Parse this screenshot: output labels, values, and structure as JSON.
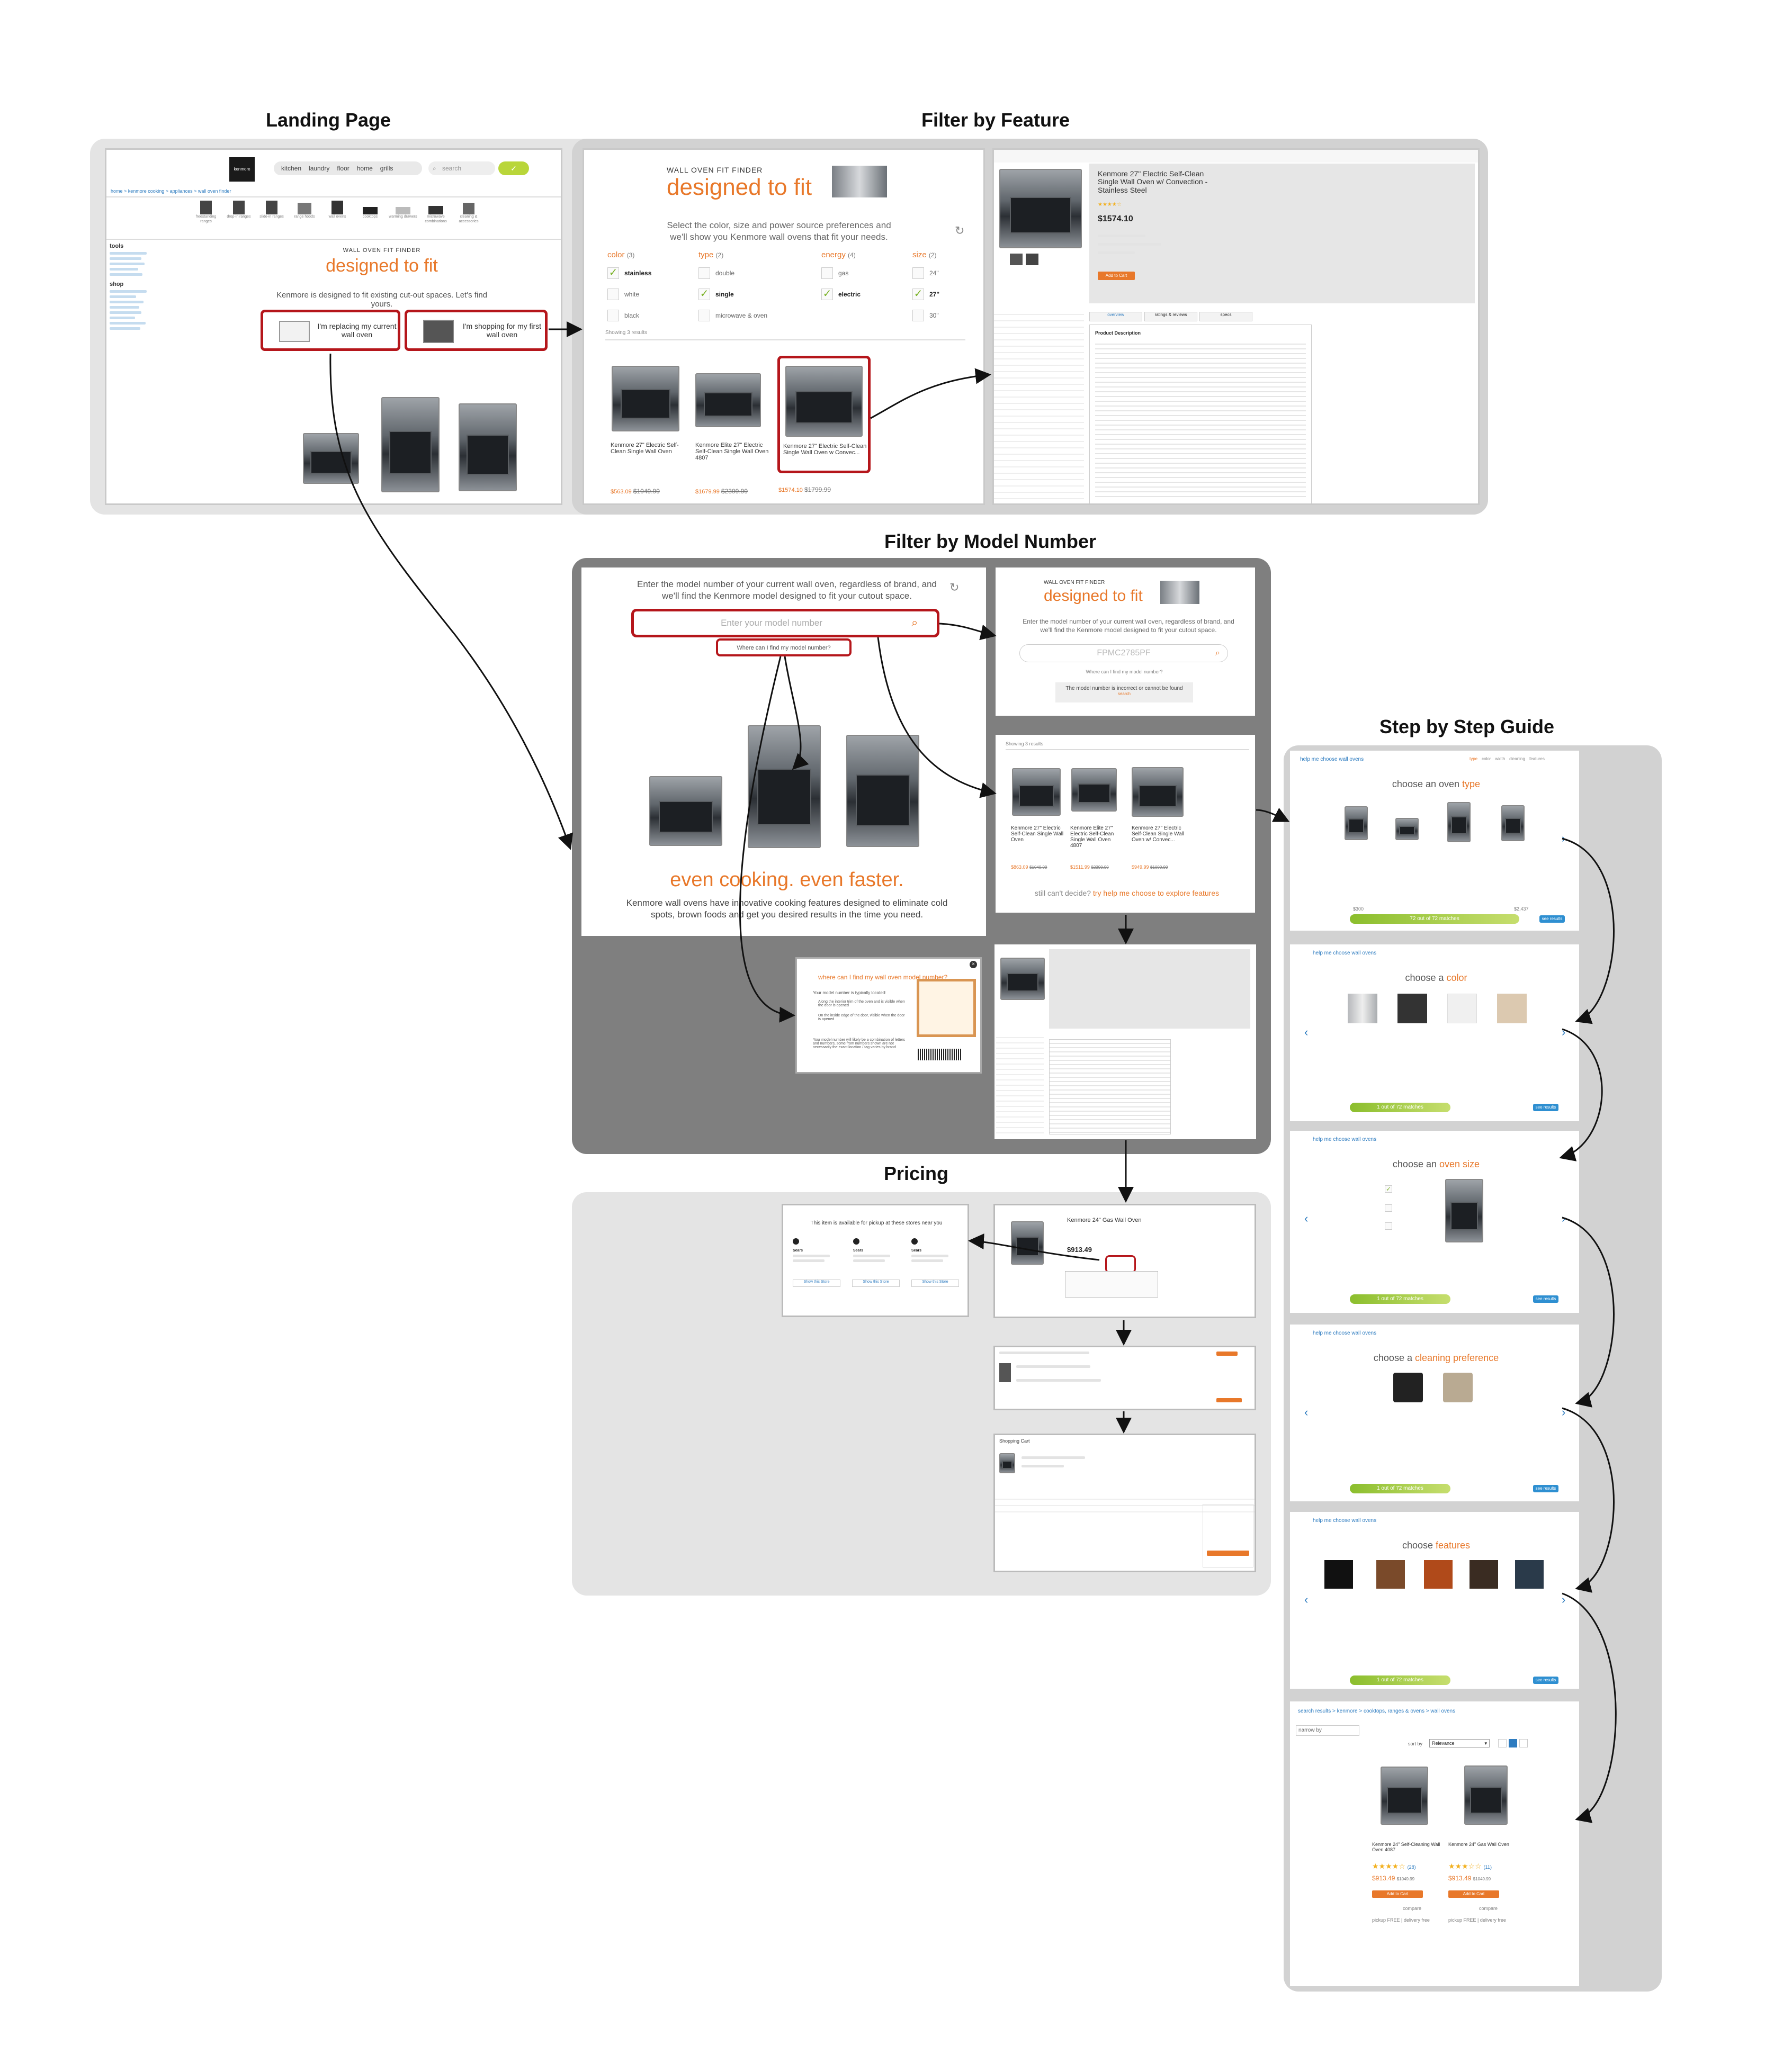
{
  "sections": {
    "landing": "Landing Page",
    "feature": "Filter by Feature",
    "model": "Filter by Model Number",
    "pricing": "Pricing",
    "steps": "Step by Step Guide"
  },
  "landing": {
    "search_placeholder": "search",
    "nav": [
      "kitchen",
      "laundry",
      "floor",
      "home",
      "grills"
    ],
    "breadcrumb": "home > kenmore cooking > appliances > wall oven finder",
    "categories": [
      "freestanding ranges",
      "drop-in ranges",
      "slide-in ranges",
      "range hoods",
      "wall ovens",
      "cooktops",
      "warming drawers",
      "microwave combinations",
      "cleaning & accessories"
    ],
    "left_nav_heading_1": "tools",
    "left_nav_heading_2": "shop",
    "finder_kicker": "WALL OVEN FIT FINDER",
    "finder_title": "designed to fit",
    "finder_sub": "Kenmore is designed to fit existing cut-out spaces. Let's find yours.",
    "btn_replace": "I'm replacing my current wall oven",
    "btn_first": "I'm shopping for my first wall oven"
  },
  "feature": {
    "kicker": "WALL OVEN FIT FINDER",
    "title": "designed to fit",
    "sub": "Select the color, size and power source preferences and we'll show you Kenmore wall ovens that fit your needs.",
    "filters": [
      {
        "name": "color",
        "count": "(3)",
        "options": [
          "stainless",
          "white",
          "black"
        ],
        "checked": [
          0
        ]
      },
      {
        "name": "type",
        "count": "(2)",
        "options": [
          "double",
          "single",
          "microwave & oven"
        ],
        "checked": [
          1
        ]
      },
      {
        "name": "energy",
        "count": "(4)",
        "options": [
          "gas",
          "electric"
        ],
        "checked": [
          1
        ]
      },
      {
        "name": "size",
        "count": "(2)",
        "options": [
          "24\"",
          "27\"",
          "30\""
        ],
        "checked": [
          1
        ]
      }
    ],
    "showing": "Showing 3 results",
    "products": [
      {
        "name": "Kenmore 27\" Electric Self-Clean Single Wall Oven",
        "price": "$563.09",
        "was": "$1049.99"
      },
      {
        "name": "Kenmore Elite 27\" Electric Self-Clean Single Wall Oven 4807",
        "price": "$1679.99",
        "was": "$2399.99"
      },
      {
        "name": "Kenmore 27\" Electric Self-Clean Single Wall Oven w Convec...",
        "price": "$1574.10",
        "was": "$1799.99"
      }
    ],
    "detail_title": "Kenmore 27\" Electric Self-Clean Single Wall Oven w/ Convection - Stainless Steel",
    "detail_price": "$1574.10",
    "detail_tabs": [
      "overview",
      "ratings & reviews",
      "specs"
    ],
    "detail_section": "Product Description",
    "add_to_cart": "Add to Cart"
  },
  "model": {
    "intro": "Enter the model number of your current wall oven, regardless of brand, and we'll find the Kenmore model designed to fit your cutout space.",
    "placeholder": "Enter your model number",
    "where_link": "Where can I find my model number?",
    "tagline": "even cooking. even faster.",
    "tagline_sub": "Kenmore wall ovens have innovative cooking features designed to eliminate cold spots, brown foods and get you desired results in the time you need.",
    "card2_kicker": "WALL OVEN FIT FINDER",
    "card2_title": "designed to fit",
    "card2_input_value": "FPMC2785PF",
    "card2_error": "The model number is incorrect or cannot be found",
    "card2_error_link": "search",
    "results_showing": "Showing 3 results",
    "results": [
      {
        "name": "Kenmore 27\" Electric Self-Clean Single Wall Oven",
        "price": "$863.09",
        "was": "$1049.99"
      },
      {
        "name": "Kenmore Elite 27\" Electric Self-Clean Single Wall Oven 4807",
        "price": "$1511.99",
        "was": "$2399.99"
      },
      {
        "name": "Kenmore 27\" Electric Self-Clean Single Wall Oven w/ Convec...",
        "price": "$949.99",
        "was": "$1099.99"
      }
    ],
    "help_prompt": "still can't decide?",
    "help_link": "try help me choose to explore features",
    "popup_title": "where can I find my wall oven model number?",
    "popup_intro": "Your model number is typically located:",
    "popup_b1": "Along the interior trim of the oven and is visible when the door is opened",
    "popup_b2": "On the inside edge of the door, visible when the door is opened",
    "popup_note": "Your model number will likely be a combination of letters and numbers, some from numbers shown are not necessarily the exact location / tag varies by brand"
  },
  "pricing": {
    "pickup_line": "This item is available for pickup at these stores near you",
    "stores": [
      "Sears",
      "Sears",
      "Sears"
    ],
    "show_store": "Show this Store",
    "product_title": "Kenmore 24\" Gas Wall Oven",
    "product_price": "$913.49",
    "cart_label": "Shopping Cart"
  },
  "steps": {
    "header": "help me choose wall ovens",
    "step_nav": [
      "type",
      "color",
      "width",
      "cleaning",
      "features"
    ],
    "cards": [
      {
        "title_pre": "choose an oven",
        "title_hl": "type",
        "matches": "72 out of 72 matches"
      },
      {
        "title_pre": "choose a",
        "title_hl": "color",
        "matches": "1 out of 72 matches"
      },
      {
        "title_pre": "choose an",
        "title_hl": "oven size",
        "matches": "1 out of 72 matches"
      },
      {
        "title_pre": "choose a",
        "title_hl": "cleaning preference",
        "matches": "1 out of 72 matches"
      },
      {
        "title_pre": "choose",
        "title_hl": "features",
        "matches": "1 out of 72 matches"
      }
    ],
    "see_results": "see results",
    "range_lo": "$300",
    "range_hi": "$2,437",
    "final_breadcrumb": "search results > kenmore > cooktops, ranges & ovens > wall ovens",
    "sort_label": "sort by",
    "sort_value": "Relevance",
    "narrow_label": "narrow by",
    "final_products": [
      {
        "name": "Kenmore 24\" Self-Cleaning Wall Oven 4087",
        "price": "$913.49",
        "was": "$1049.99",
        "reviews": "(28)"
      },
      {
        "name": "Kenmore 24\" Gas Wall Oven",
        "price": "$913.49",
        "was": "$1049.99",
        "reviews": "(11)"
      }
    ],
    "final_add": "Add to Cart",
    "final_compare": "compare",
    "final_pickup": "pickup FREE | delivery free"
  }
}
